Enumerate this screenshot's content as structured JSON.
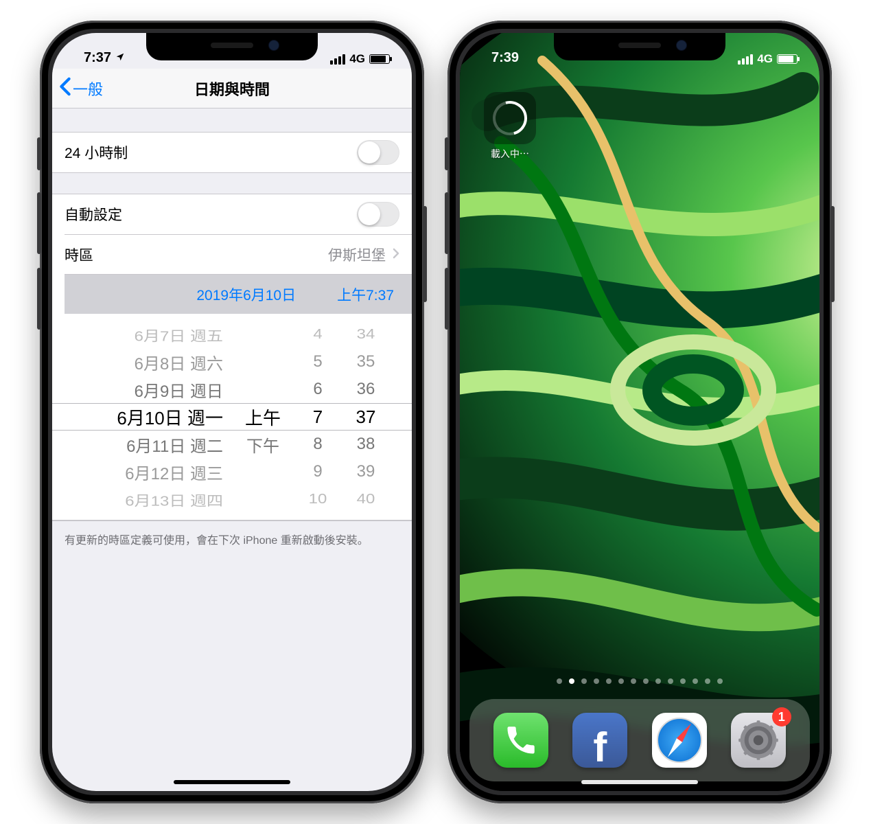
{
  "left": {
    "status": {
      "time": "7:37",
      "network": "4G",
      "location_icon": "location-arrow"
    },
    "nav": {
      "back_label": "一般",
      "title": "日期與時間"
    },
    "cells": {
      "twenty_four_hour": {
        "label": "24 小時制",
        "on": false
      },
      "auto_set": {
        "label": "自動設定",
        "on": false
      },
      "timezone": {
        "label": "時區",
        "value": "伊斯坦堡"
      },
      "datetime": {
        "date": "2019年6月10日",
        "time": "上午7:37"
      }
    },
    "picker": {
      "rows": [
        {
          "d": "6月7日 週五",
          "ampm": "",
          "h": "4",
          "m": "34",
          "cls": "fade1"
        },
        {
          "d": "6月8日 週六",
          "ampm": "",
          "h": "5",
          "m": "35",
          "cls": "fade2"
        },
        {
          "d": "6月9日 週日",
          "ampm": "",
          "h": "6",
          "m": "36",
          "cls": "fade3"
        },
        {
          "d": "6月10日 週一",
          "ampm": "上午",
          "h": "7",
          "m": "37",
          "cls": "sel-row"
        },
        {
          "d": "6月11日 週二",
          "ampm": "下午",
          "h": "8",
          "m": "38",
          "cls": "fade3"
        },
        {
          "d": "6月12日 週三",
          "ampm": "",
          "h": "9",
          "m": "39",
          "cls": "fade2"
        },
        {
          "d": "6月13日 週四",
          "ampm": "",
          "h": "10",
          "m": "40",
          "cls": "fade1"
        }
      ]
    },
    "footer": "有更新的時區定義可使用，會在下次 iPhone 重新啟動後安裝。"
  },
  "right": {
    "status": {
      "time": "7:39",
      "network": "4G"
    },
    "loading_app": {
      "label": "載入中⋯"
    },
    "page_dots": {
      "count": 14,
      "active": 1
    },
    "dock": {
      "apps": [
        {
          "name": "phone",
          "badge": null
        },
        {
          "name": "facebook",
          "badge": null
        },
        {
          "name": "safari",
          "badge": null
        },
        {
          "name": "settings",
          "badge": "1"
        }
      ]
    }
  },
  "colors": {
    "ios_blue": "#007aff",
    "badge_red": "#ff3b30"
  }
}
